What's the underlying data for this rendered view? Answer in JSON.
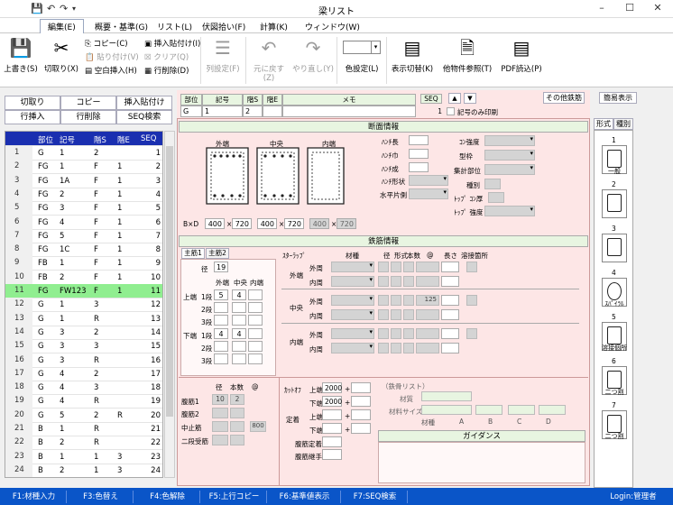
{
  "window": {
    "title": "梁リスト",
    "minimize": "–",
    "maximize": "☐",
    "close": "✕"
  },
  "menu": [
    {
      "label": "編集(E)",
      "active": true
    },
    {
      "label": "概要・基準(G)"
    },
    {
      "label": "リスト(L)"
    },
    {
      "label": "伏図拾い(F)"
    },
    {
      "label": "計算(K)"
    },
    {
      "label": "ウィンドウ(W)"
    }
  ],
  "ribbon": {
    "save": "上書き(S)",
    "cut": "切取り(X)",
    "copy": "コピー(C)",
    "paste": "貼り付け(V)",
    "blank_insert": "空白挿入(H)",
    "insert_paste": "挿入貼付け(I)",
    "clear": "クリア(Q)",
    "row_delete": "行削除(D)",
    "column_display": "列設定(F)",
    "undo": "元に戻す(Z)",
    "redo": "やり直し(Y)",
    "color_setting": "色設定(L)",
    "display_switch": "表示切替(K)",
    "other_property": "他物件参照(T)",
    "pdf_import": "PDF読込(P)"
  },
  "edit_buttons": [
    "切取り",
    "コピー",
    "挿入貼付け",
    "行挿入",
    "行削除",
    "SEQ検索"
  ],
  "grid": {
    "headers": [
      "部位",
      "記号",
      "階S",
      "階E",
      "SEQ"
    ],
    "selected_row": 11,
    "rows": [
      [
        "1",
        "G",
        "1",
        "2",
        "",
        "1"
      ],
      [
        "2",
        "FG",
        "1",
        "F",
        "1",
        "2"
      ],
      [
        "3",
        "FG",
        "1A",
        "F",
        "1",
        "3"
      ],
      [
        "4",
        "FG",
        "2",
        "F",
        "1",
        "4"
      ],
      [
        "5",
        "FG",
        "3",
        "F",
        "1",
        "5"
      ],
      [
        "6",
        "FG",
        "4",
        "F",
        "1",
        "6"
      ],
      [
        "7",
        "FG",
        "5",
        "F",
        "1",
        "7"
      ],
      [
        "8",
        "FG",
        "1C",
        "F",
        "1",
        "8"
      ],
      [
        "9",
        "FB",
        "1",
        "F",
        "1",
        "9"
      ],
      [
        "10",
        "FB",
        "2",
        "F",
        "1",
        "10"
      ],
      [
        "11",
        "FG",
        "FW123",
        "F",
        "1",
        "11"
      ],
      [
        "12",
        "G",
        "1",
        "3",
        "",
        "12"
      ],
      [
        "13",
        "G",
        "1",
        "R",
        "",
        "13"
      ],
      [
        "14",
        "G",
        "3",
        "2",
        "",
        "14"
      ],
      [
        "15",
        "G",
        "3",
        "3",
        "",
        "15"
      ],
      [
        "16",
        "G",
        "3",
        "R",
        "",
        "16"
      ],
      [
        "17",
        "G",
        "4",
        "2",
        "",
        "17"
      ],
      [
        "18",
        "G",
        "4",
        "3",
        "",
        "18"
      ],
      [
        "19",
        "G",
        "4",
        "R",
        "",
        "19"
      ],
      [
        "20",
        "G",
        "5",
        "2",
        "R",
        "20"
      ],
      [
        "21",
        "B",
        "1",
        "R",
        "",
        "21"
      ],
      [
        "22",
        "B",
        "2",
        "R",
        "",
        "22"
      ],
      [
        "23",
        "B",
        "1",
        "1",
        "3",
        "23"
      ],
      [
        "24",
        "B",
        "2",
        "1",
        "3",
        "24"
      ]
    ]
  },
  "header_fields": {
    "labels": [
      "部位",
      "記号",
      "階S",
      "階E",
      "メモ",
      "SEQ"
    ],
    "values": [
      "G",
      "1",
      "2",
      "",
      ""
    ],
    "seq_value": "1",
    "print_only_label": "記号のみ印刷",
    "other_rebar": "その他鉄筋",
    "simple_display": "簡易表示"
  },
  "section": {
    "title": "断面情報",
    "outer_end": "外端",
    "center": "中央",
    "inner_end": "内端",
    "bxd": "B×D",
    "dims": [
      "400",
      "720",
      "400",
      "720",
      "400",
      "720"
    ],
    "times": "×",
    "haunch": [
      "ﾊﾝﾁ長",
      "ﾊﾝﾁ巾",
      "ﾊﾝﾁ成",
      "ﾊﾝﾁ形状",
      "水平片側"
    ],
    "concrete": [
      "ｺﾝ強度",
      "型枠",
      "集計部位",
      "種別",
      "ﾄｯﾌﾟ ｺﾝ厚",
      "ﾄｯﾌﾟ 強度"
    ]
  },
  "rebar": {
    "title": "鉄筋情報",
    "tab1": "主筋1",
    "tab2": "主筋2",
    "diameter_label": "径",
    "diameter": "19",
    "cols": [
      "外端",
      "中央",
      "内端"
    ],
    "top_label": "上端",
    "bottom_label": "下端",
    "rows": [
      "1段",
      "2段",
      "3段",
      "1段",
      "2段",
      "3段"
    ],
    "top1": [
      "5",
      "4",
      ""
    ],
    "bottom1": [
      "4",
      "4",
      ""
    ],
    "stirrup": "ｽﾀｰﾗｯﾌﾟ",
    "stirrup_cols": [
      "材種",
      "径",
      "形式",
      "本数",
      "@",
      "長さ",
      "溶接箇所"
    ],
    "outer_end": "外端",
    "center": "中央",
    "inner_end": "内端",
    "outer": "外周",
    "inner": "内周",
    "pitch": "125"
  },
  "bottom": {
    "diam": "径",
    "count": "本数",
    "at": "@",
    "web1": "腹筋1",
    "web1_vals": [
      "10",
      "2"
    ],
    "web2": "腹筋2",
    "middle": "中止筋",
    "middle_val": "800",
    "double": "二段受筋",
    "cutoff": "ｶｯﾄｵﾌ",
    "top": "上端",
    "top_val": "2000",
    "bottom": "下端",
    "bottom_val": "2000",
    "anchor": "定着",
    "plus": "+",
    "web_anchor": "腹筋定着",
    "web_joint": "腹筋継手",
    "steel_list": "（鉄骨リスト）",
    "material": "材質",
    "size": "材料サイズ",
    "mat_cols": [
      "材種",
      "A",
      "B",
      "C",
      "D"
    ],
    "guidance": "ガイダンス"
  },
  "side": {
    "tab1": "形式",
    "tab2": "種別",
    "items": [
      {
        "n": "1",
        "label": "一般"
      },
      {
        "n": "2",
        "label": ""
      },
      {
        "n": "3",
        "label": ""
      },
      {
        "n": "4",
        "label": "ｽﾊﾟｲﾗﾙ"
      },
      {
        "n": "5",
        "label": "溶接個所"
      },
      {
        "n": "6",
        "label": "二つ割"
      },
      {
        "n": "7",
        "label": "二つ割"
      }
    ]
  },
  "status": {
    "keys": [
      "F1:材種入力",
      "F3:色替え",
      "F4:色解除",
      "F5:上行コピー",
      "F6:基準値表示",
      "F7:SEQ検索"
    ],
    "login": "Login:管理者"
  }
}
